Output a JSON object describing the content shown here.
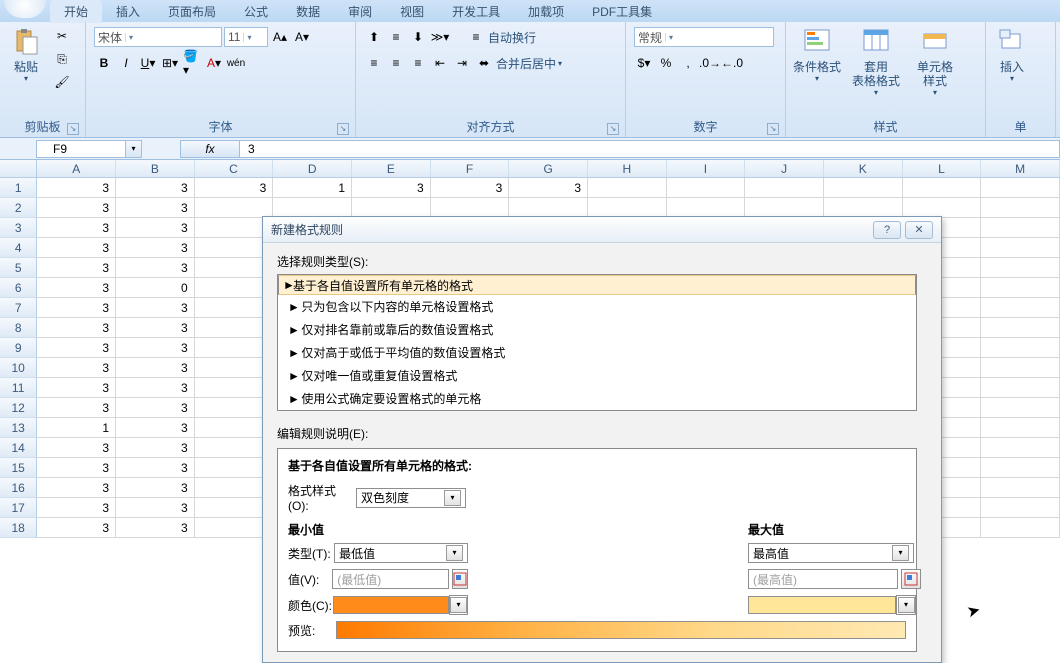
{
  "ribbon": {
    "tabs": [
      "开始",
      "插入",
      "页面布局",
      "公式",
      "数据",
      "审阅",
      "视图",
      "开发工具",
      "加载项",
      "PDF工具集"
    ],
    "clipboard": {
      "paste": "粘贴",
      "label": "剪贴板"
    },
    "font": {
      "name": "宋体",
      "size": "11",
      "label": "字体"
    },
    "align": {
      "wrap": "自动换行",
      "merge": "合并后居中",
      "label": "对齐方式"
    },
    "number": {
      "format": "常规",
      "label": "数字"
    },
    "styles": {
      "cond": "条件格式",
      "table": "套用\n表格格式",
      "cell": "单元格\n样式",
      "label": "样式"
    },
    "cells": {
      "insert": "插入",
      "label": "单"
    }
  },
  "fx": {
    "cellref": "F9",
    "value": "3"
  },
  "cols": [
    "A",
    "B",
    "C",
    "D",
    "E",
    "F",
    "G",
    "H",
    "I",
    "J",
    "K",
    "L",
    "M"
  ],
  "sheet": [
    [
      "3",
      "3",
      "3",
      "1",
      "3",
      "3",
      "3",
      "",
      "",
      "",
      "",
      "",
      ""
    ],
    [
      "3",
      "3",
      "",
      "",
      "",
      "",
      "",
      "",
      "",
      "",
      "",
      "",
      ""
    ],
    [
      "3",
      "3",
      "",
      "",
      "",
      "",
      "",
      "",
      "",
      "",
      "",
      "",
      ""
    ],
    [
      "3",
      "3",
      "",
      "",
      "",
      "",
      "",
      "",
      "",
      "",
      "",
      "",
      ""
    ],
    [
      "3",
      "3",
      "",
      "",
      "",
      "",
      "",
      "",
      "",
      "",
      "",
      "",
      ""
    ],
    [
      "3",
      "0",
      "",
      "",
      "",
      "",
      "",
      "",
      "",
      "",
      "",
      "",
      ""
    ],
    [
      "3",
      "3",
      "",
      "",
      "",
      "",
      "",
      "",
      "",
      "",
      "",
      "",
      ""
    ],
    [
      "3",
      "3",
      "",
      "",
      "",
      "",
      "",
      "",
      "",
      "",
      "",
      "",
      ""
    ],
    [
      "3",
      "3",
      "",
      "",
      "",
      "",
      "",
      "",
      "",
      "",
      "",
      "",
      ""
    ],
    [
      "3",
      "3",
      "",
      "",
      "",
      "",
      "",
      "",
      "",
      "",
      "",
      "",
      ""
    ],
    [
      "3",
      "3",
      "",
      "",
      "",
      "",
      "",
      "",
      "",
      "",
      "",
      "",
      ""
    ],
    [
      "3",
      "3",
      "",
      "",
      "",
      "",
      "",
      "",
      "",
      "",
      "",
      "",
      ""
    ],
    [
      "1",
      "3",
      "",
      "",
      "",
      "",
      "",
      "",
      "",
      "",
      "",
      "",
      ""
    ],
    [
      "3",
      "3",
      "",
      "",
      "",
      "",
      "",
      "",
      "",
      "",
      "",
      "",
      ""
    ],
    [
      "3",
      "3",
      "",
      "",
      "",
      "",
      "",
      "",
      "",
      "",
      "",
      "",
      ""
    ],
    [
      "3",
      "3",
      "",
      "",
      "",
      "",
      "",
      "",
      "",
      "",
      "",
      "",
      ""
    ],
    [
      "3",
      "3",
      "",
      "",
      "",
      "",
      "",
      "",
      "",
      "",
      "",
      "",
      ""
    ],
    [
      "3",
      "3",
      "",
      "",
      "",
      "",
      "",
      "",
      "",
      "",
      "",
      "",
      ""
    ]
  ],
  "dialog": {
    "title": "新建格式规则",
    "help": "?",
    "close": "✕",
    "select_label": "选择规则类型(S):",
    "rules": [
      "基于各自值设置所有单元格的格式",
      "只为包含以下内容的单元格设置格式",
      "仅对排名靠前或靠后的数值设置格式",
      "仅对高于或低于平均值的数值设置格式",
      "仅对唯一值或重复值设置格式",
      "使用公式确定要设置格式的单元格"
    ],
    "edit_label": "编辑规则说明(E):",
    "panel_head": "基于各自值设置所有单元格的格式:",
    "style_label": "格式样式(O):",
    "style_value": "双色刻度",
    "min_head": "最小值",
    "max_head": "最大值",
    "type_label": "类型(T):",
    "type_min": "最低值",
    "type_max": "最高值",
    "value_label": "值(V):",
    "value_min_ph": "(最低值)",
    "value_max_ph": "(最高值)",
    "color_label": "颜色(C):",
    "preview_label": "预览:"
  }
}
